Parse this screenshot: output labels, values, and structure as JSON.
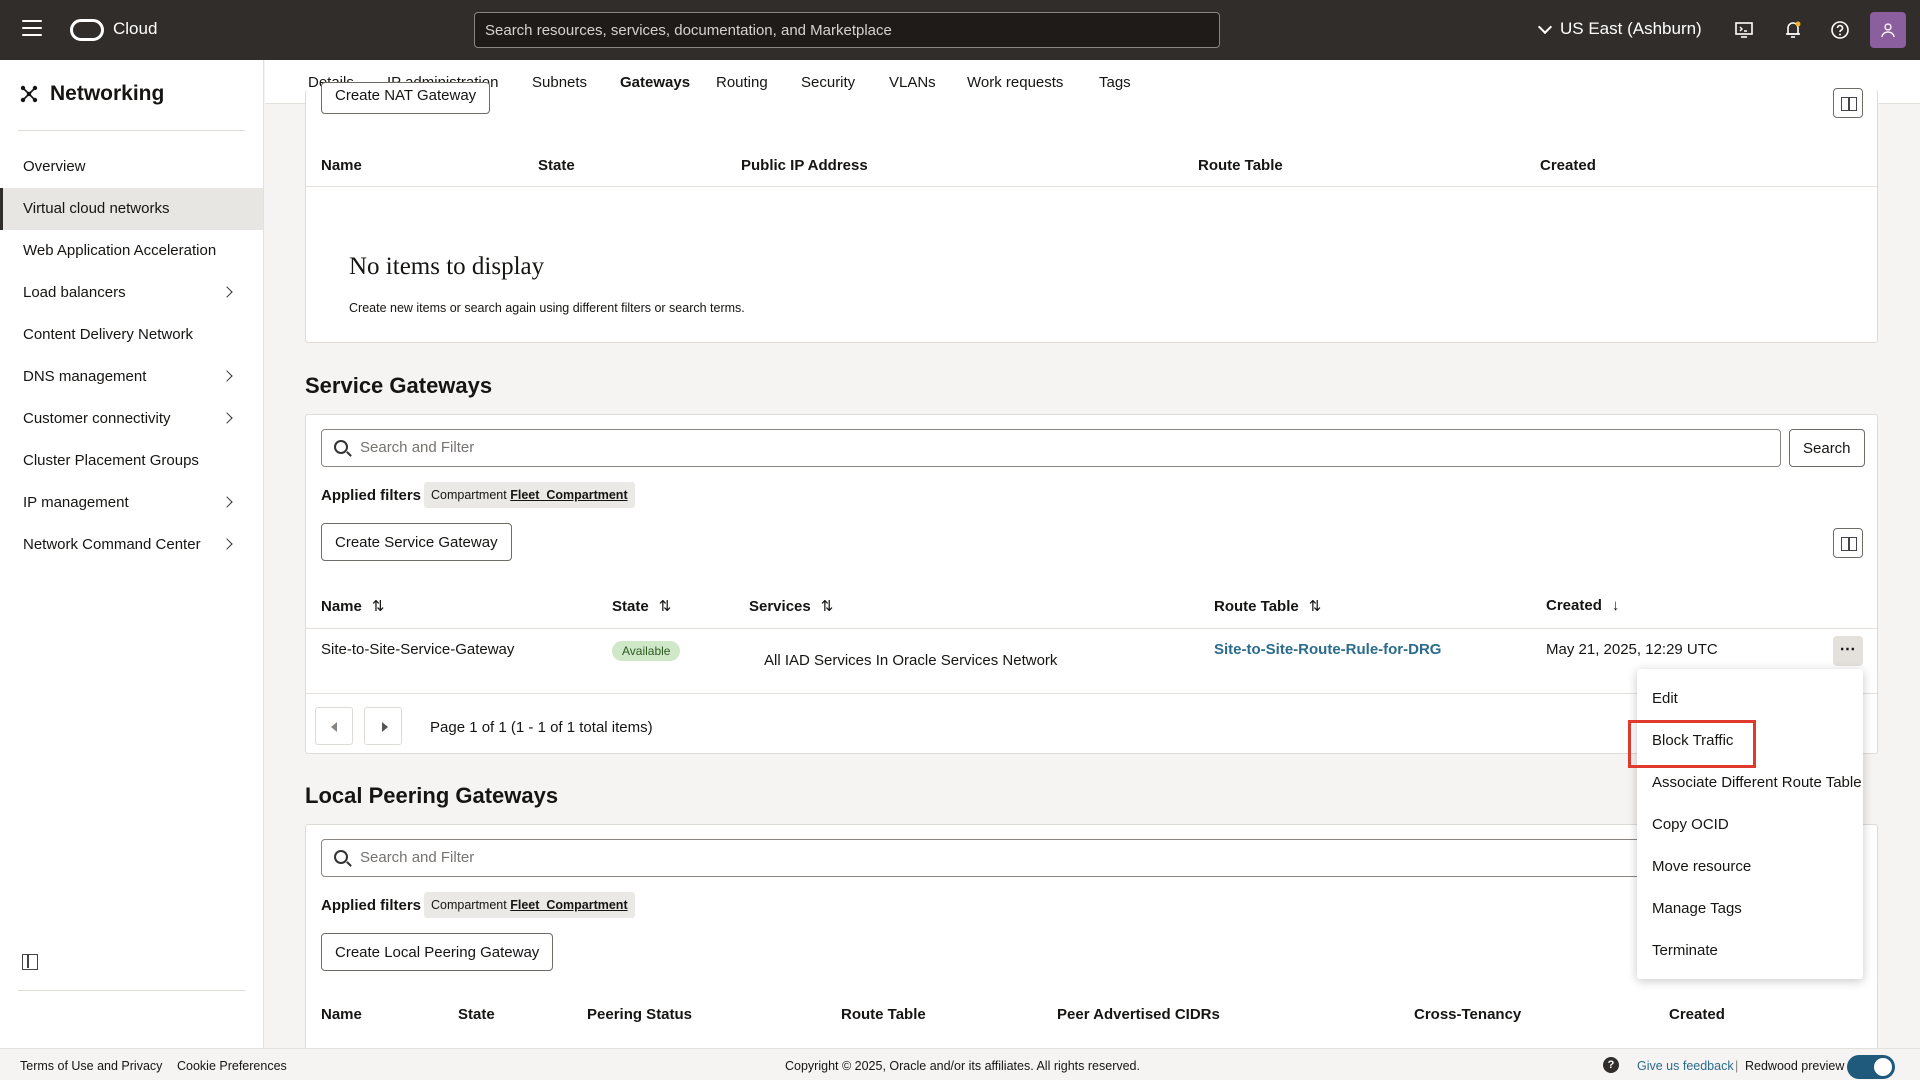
{
  "header": {
    "brand": "Cloud",
    "search_placeholder": "Search resources, services, documentation, and Marketplace",
    "region": "US East (Ashburn)"
  },
  "sidebar": {
    "title": "Networking",
    "items": [
      {
        "label": "Overview"
      },
      {
        "label": "Virtual cloud networks"
      },
      {
        "label": "Web Application Acceleration"
      },
      {
        "label": "Load balancers"
      },
      {
        "label": "Content Delivery Network"
      },
      {
        "label": "DNS management"
      },
      {
        "label": "Customer connectivity"
      },
      {
        "label": "Cluster Placement Groups"
      },
      {
        "label": "IP management"
      },
      {
        "label": "Network Command Center"
      }
    ]
  },
  "tabs": [
    "Details",
    "IP administration",
    "Subnets",
    "Gateways",
    "Routing",
    "Security",
    "VLANs",
    "Work requests",
    "Tags"
  ],
  "nat": {
    "create_button": "Create NAT Gateway",
    "columns": [
      "Name",
      "State",
      "Public IP Address",
      "Route Table",
      "Created"
    ],
    "empty_title": "No items to display",
    "empty_text": "Create new items or search again using different filters or search terms."
  },
  "service_gateways": {
    "title": "Service Gateways",
    "search_placeholder": "Search and Filter",
    "search_button": "Search",
    "applied_label": "Applied filters",
    "chip_key": "Compartment",
    "chip_value": "Fleet_Compartment",
    "create_button": "Create Service Gateway",
    "columns": [
      "Name",
      "State",
      "Services",
      "Route Table",
      "Created"
    ],
    "row": {
      "name": "Site-to-Site-Service-Gateway",
      "state": "Available",
      "services": "All IAD Services In Oracle Services Network",
      "route_table": "Site-to-Site-Route-Rule-for-DRG",
      "created": "May 21, 2025, 12:29 UTC"
    },
    "pagination": "Page 1 of 1 (1 - 1 of 1 total items)"
  },
  "local_peering": {
    "title": "Local Peering Gateways",
    "search_placeholder": "Search and Filter",
    "applied_label": "Applied filters",
    "chip_key": "Compartment",
    "chip_value": "Fleet_Compartment",
    "create_button": "Create Local Peering Gateway",
    "columns": [
      "Name",
      "State",
      "Peering Status",
      "Route Table",
      "Peer Advertised CIDRs",
      "Cross-Tenancy",
      "Created"
    ]
  },
  "actions_menu": [
    "Edit",
    "Block Traffic",
    "Associate Different Route Table",
    "Copy OCID",
    "Move resource",
    "Manage Tags",
    "Terminate"
  ],
  "footer": {
    "terms": "Terms of Use and Privacy",
    "cookies": "Cookie Preferences",
    "copyright": "Copyright © 2025, Oracle and/or its affiliates. All rights reserved.",
    "feedback": "Give us feedback",
    "separator": "|",
    "redwood": "Redwood preview"
  }
}
